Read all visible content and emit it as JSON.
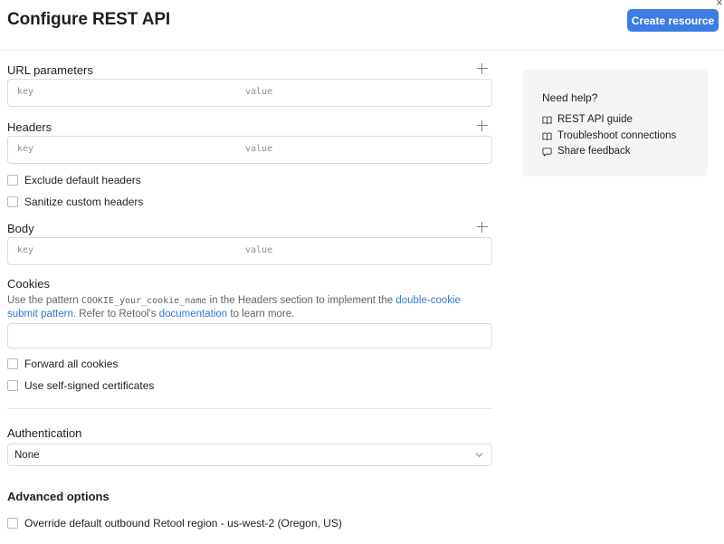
{
  "header": {
    "title": "Configure REST API",
    "create_button": "Create resource",
    "close_glyph": "×"
  },
  "url_parameters": {
    "label": "URL parameters",
    "key_placeholder": "key",
    "value_placeholder": "value"
  },
  "headers": {
    "label": "Headers",
    "key_placeholder": "key",
    "value_placeholder": "value",
    "exclude_default": "Exclude default headers",
    "sanitize_custom": "Sanitize custom headers"
  },
  "body_section": {
    "label": "Body",
    "key_placeholder": "key",
    "value_placeholder": "value"
  },
  "cookies": {
    "label": "Cookies",
    "desc_part1": "Use the pattern ",
    "desc_code": "COOKIE_your_cookie_name",
    "desc_part2": " in the Headers section to implement the ",
    "desc_link1": "double-cookie submit pattern",
    "desc_part3": ". Refer to Retool's ",
    "desc_link2": "documentation",
    "desc_part4": " to learn more.",
    "input_value": ""
  },
  "options": {
    "forward_cookies": "Forward all cookies",
    "self_signed": "Use self-signed certificates"
  },
  "authentication": {
    "label": "Authentication",
    "selected": "None"
  },
  "advanced": {
    "heading": "Advanced options",
    "override_region": "Override default outbound Retool region - us-west-2 (Oregon, US)"
  },
  "help": {
    "title": "Need help?",
    "items": [
      {
        "label": "REST API guide",
        "icon": "book-icon"
      },
      {
        "label": "Troubleshoot connections",
        "icon": "book-icon"
      },
      {
        "label": "Share feedback",
        "icon": "chat-bubble-icon"
      }
    ]
  },
  "colors": {
    "primary": "#3d7de3",
    "link": "#2f7bd4",
    "border": "#d9dbde",
    "help_background": "#f5f5f6"
  }
}
